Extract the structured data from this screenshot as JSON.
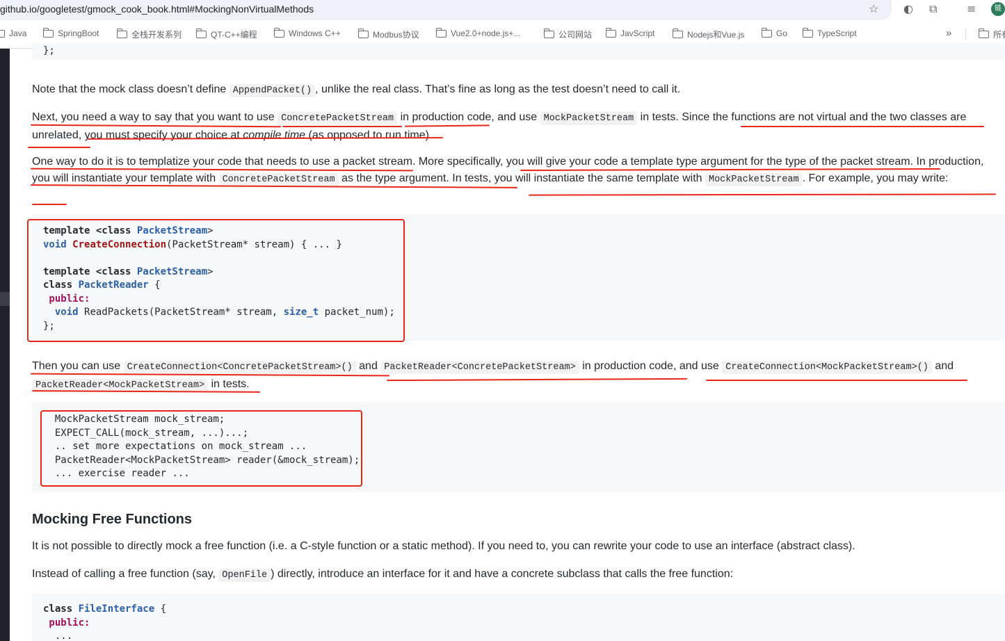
{
  "browser": {
    "url": "github.io/googletest/gmock_cook_book.html#MockingNonVirtualMethods",
    "profile_initial": "链",
    "bookmarks": [
      {
        "label": "Java"
      },
      {
        "label": "SpringBoot"
      },
      {
        "label": "全栈开发系列"
      },
      {
        "label": "QT-C++编程"
      },
      {
        "label": "Windows C++"
      },
      {
        "label": "Modbus协议"
      },
      {
        "label": "Vue2.0+node.js+..."
      },
      {
        "label": "公司网站"
      },
      {
        "label": "JavScript"
      },
      {
        "label": "Nodejs和Vue.js"
      },
      {
        "label": "Go"
      },
      {
        "label": "TypeScript"
      }
    ],
    "more_bookmarks": "»",
    "all_bookmarks": "所有"
  },
  "page": {
    "top_code_tail": "};",
    "p1": {
      "a": "Note that the mock class doesn’t define ",
      "code1": "AppendPacket()",
      "b": ", unlike the real class. That’s fine as long as the test doesn’t need to call it."
    },
    "p2": {
      "a": "Next, you need a way to say that you want to use ",
      "code1": "ConcretePacketStream",
      "b": " in production code, and use ",
      "code2": "MockPacketStream",
      "c": " in tests. Since the functions are not virtual and the two classes are unrelated, you must specify your choice at ",
      "em": "compile time",
      "d": " (as opposed to run time)."
    },
    "p3": {
      "a": "One way to do it is to templatize your code that needs to use a packet stream. More specifically, you will give your code a template type argument for the type of the packet stream. In production, you will instantiate your template with ",
      "code1": "ConcretePacketStream",
      "b": " as the type argument. In tests, you will instantiate the same template with ",
      "code2": "MockPacketStream",
      "c": ". For example, you may write:"
    },
    "code1": {
      "l1_kw": "template <class ",
      "l1_ty": "PacketStream",
      "l1_end": ">",
      "l2_kw": "void ",
      "l2_fn": "CreateConnection",
      "l2_rest": "(PacketStream* stream) { ... }",
      "l4_kw": "template <class ",
      "l4_ty": "PacketStream",
      "l4_end": ">",
      "l5_kw": "class ",
      "l5_ty": "PacketReader",
      "l5_rest": " {",
      "l6_acc": " public:",
      "l7_kw": "  void ",
      "l7_a": "ReadPackets(PacketStream* stream, ",
      "l7_ty": "size_t",
      "l7_b": " packet_num);",
      "l8": "};"
    },
    "p4": {
      "a": "Then you can use ",
      "code1": "CreateConnection<ConcretePacketStream>()",
      "b": " and ",
      "code2": "PacketReader<ConcretePacketStream>",
      "c": " in production code, and use ",
      "code3": "CreateConnection<MockPacketStream>()",
      "d": " and ",
      "code4": "PacketReader<MockPacketStream>",
      "e": " in tests."
    },
    "code2": {
      "l1": "  MockPacketStream mock_stream;",
      "l2": "  EXPECT_CALL(mock_stream, ...)...;",
      "l3": "  .. set more expectations on mock_stream ...",
      "l4": "  PacketReader<MockPacketStream> reader(&mock_stream);",
      "l5": "  ... exercise reader ..."
    },
    "heading": "Mocking Free Functions",
    "p5": "It is not possible to directly mock a free function (i.e. a C-style function or a static method). If you need to, you can rewrite your code to use an interface (abstract class).",
    "p6": {
      "a": "Instead of calling a free function (say, ",
      "code1": "OpenFile",
      "b": ") directly, introduce an interface for it and have a concrete subclass that calls the free function:"
    },
    "code3": {
      "l1_kw": "class ",
      "l1_ty": "FileInterface",
      "l1_rest": " {",
      "l2_acc": " public:",
      "l3": "  ..."
    }
  },
  "colors": {
    "annotation": "#e8261a",
    "code_bg": "#f6f8fa",
    "text": "#24292f"
  }
}
